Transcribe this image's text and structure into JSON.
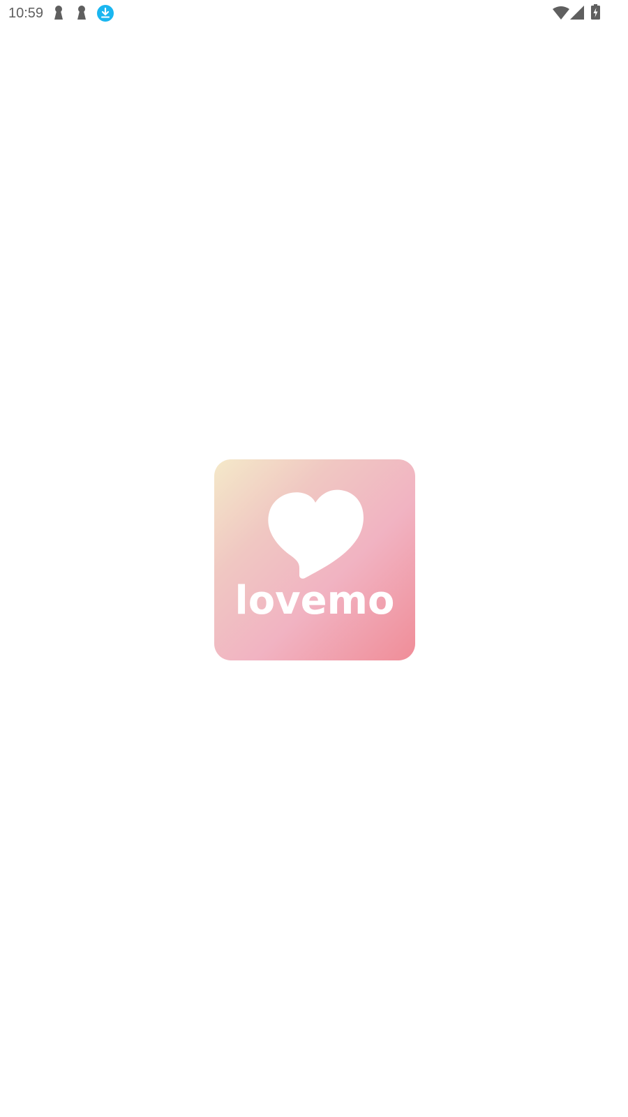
{
  "status_bar": {
    "time": "10:59",
    "icons": [
      "keyhole-icon",
      "keyhole-icon",
      "download-icon",
      "wifi-icon",
      "cellular-signal-icon",
      "battery-charging-icon"
    ],
    "download_color": "#1ab6f0",
    "icon_color": "#5f5f5f"
  },
  "splash": {
    "logo_text": "lovemo",
    "logo_icon": "heart-speech-bubble-icon",
    "gradient_colors": [
      "#f4e9c9",
      "#f0c7c2",
      "#f1b3c2",
      "#f08d98"
    ],
    "background": "#ffffff"
  }
}
